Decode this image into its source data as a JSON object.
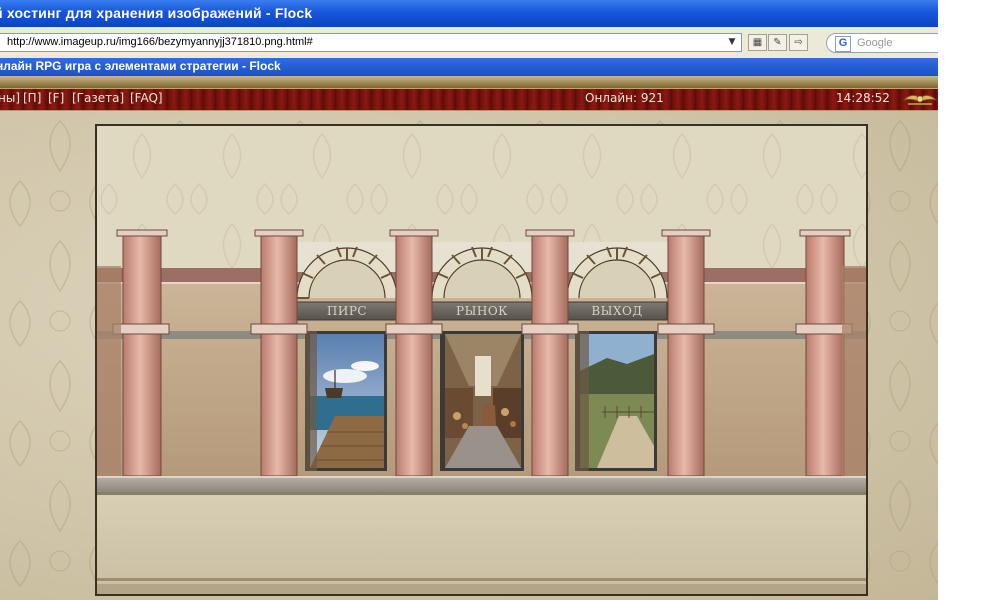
{
  "browser": {
    "window_title": "й хостинг для хранения изображений - Flock",
    "url": "http://www.imageup.ru/img166/bezymyannyjj371810.png.html#",
    "search_placeholder": "Google",
    "search_engine_icon": "google-g-icon"
  },
  "page": {
    "title": "нлайн RPG игра с элементами стратегии - Flock"
  },
  "game_header": {
    "links": [
      "ны]",
      "[П]",
      "[F]",
      "[Газета]",
      "[FAQ]"
    ],
    "online_text": "Онлайн: 921",
    "time": "14:28:52",
    "emblem_icon": "winged-emblem-icon"
  },
  "scene": {
    "locations": [
      {
        "label": "ПИРС",
        "icon": "pier-sea-icon"
      },
      {
        "label": "РЫНОК",
        "icon": "market-street-icon"
      },
      {
        "label": "ВЫХОД",
        "icon": "road-exit-icon"
      }
    ]
  },
  "colors": {
    "title_blue": "#0a45c8",
    "status_red": "#6a0f0b",
    "column_pink": "#d49a8a",
    "wall_tan": "#c3ac8a"
  }
}
